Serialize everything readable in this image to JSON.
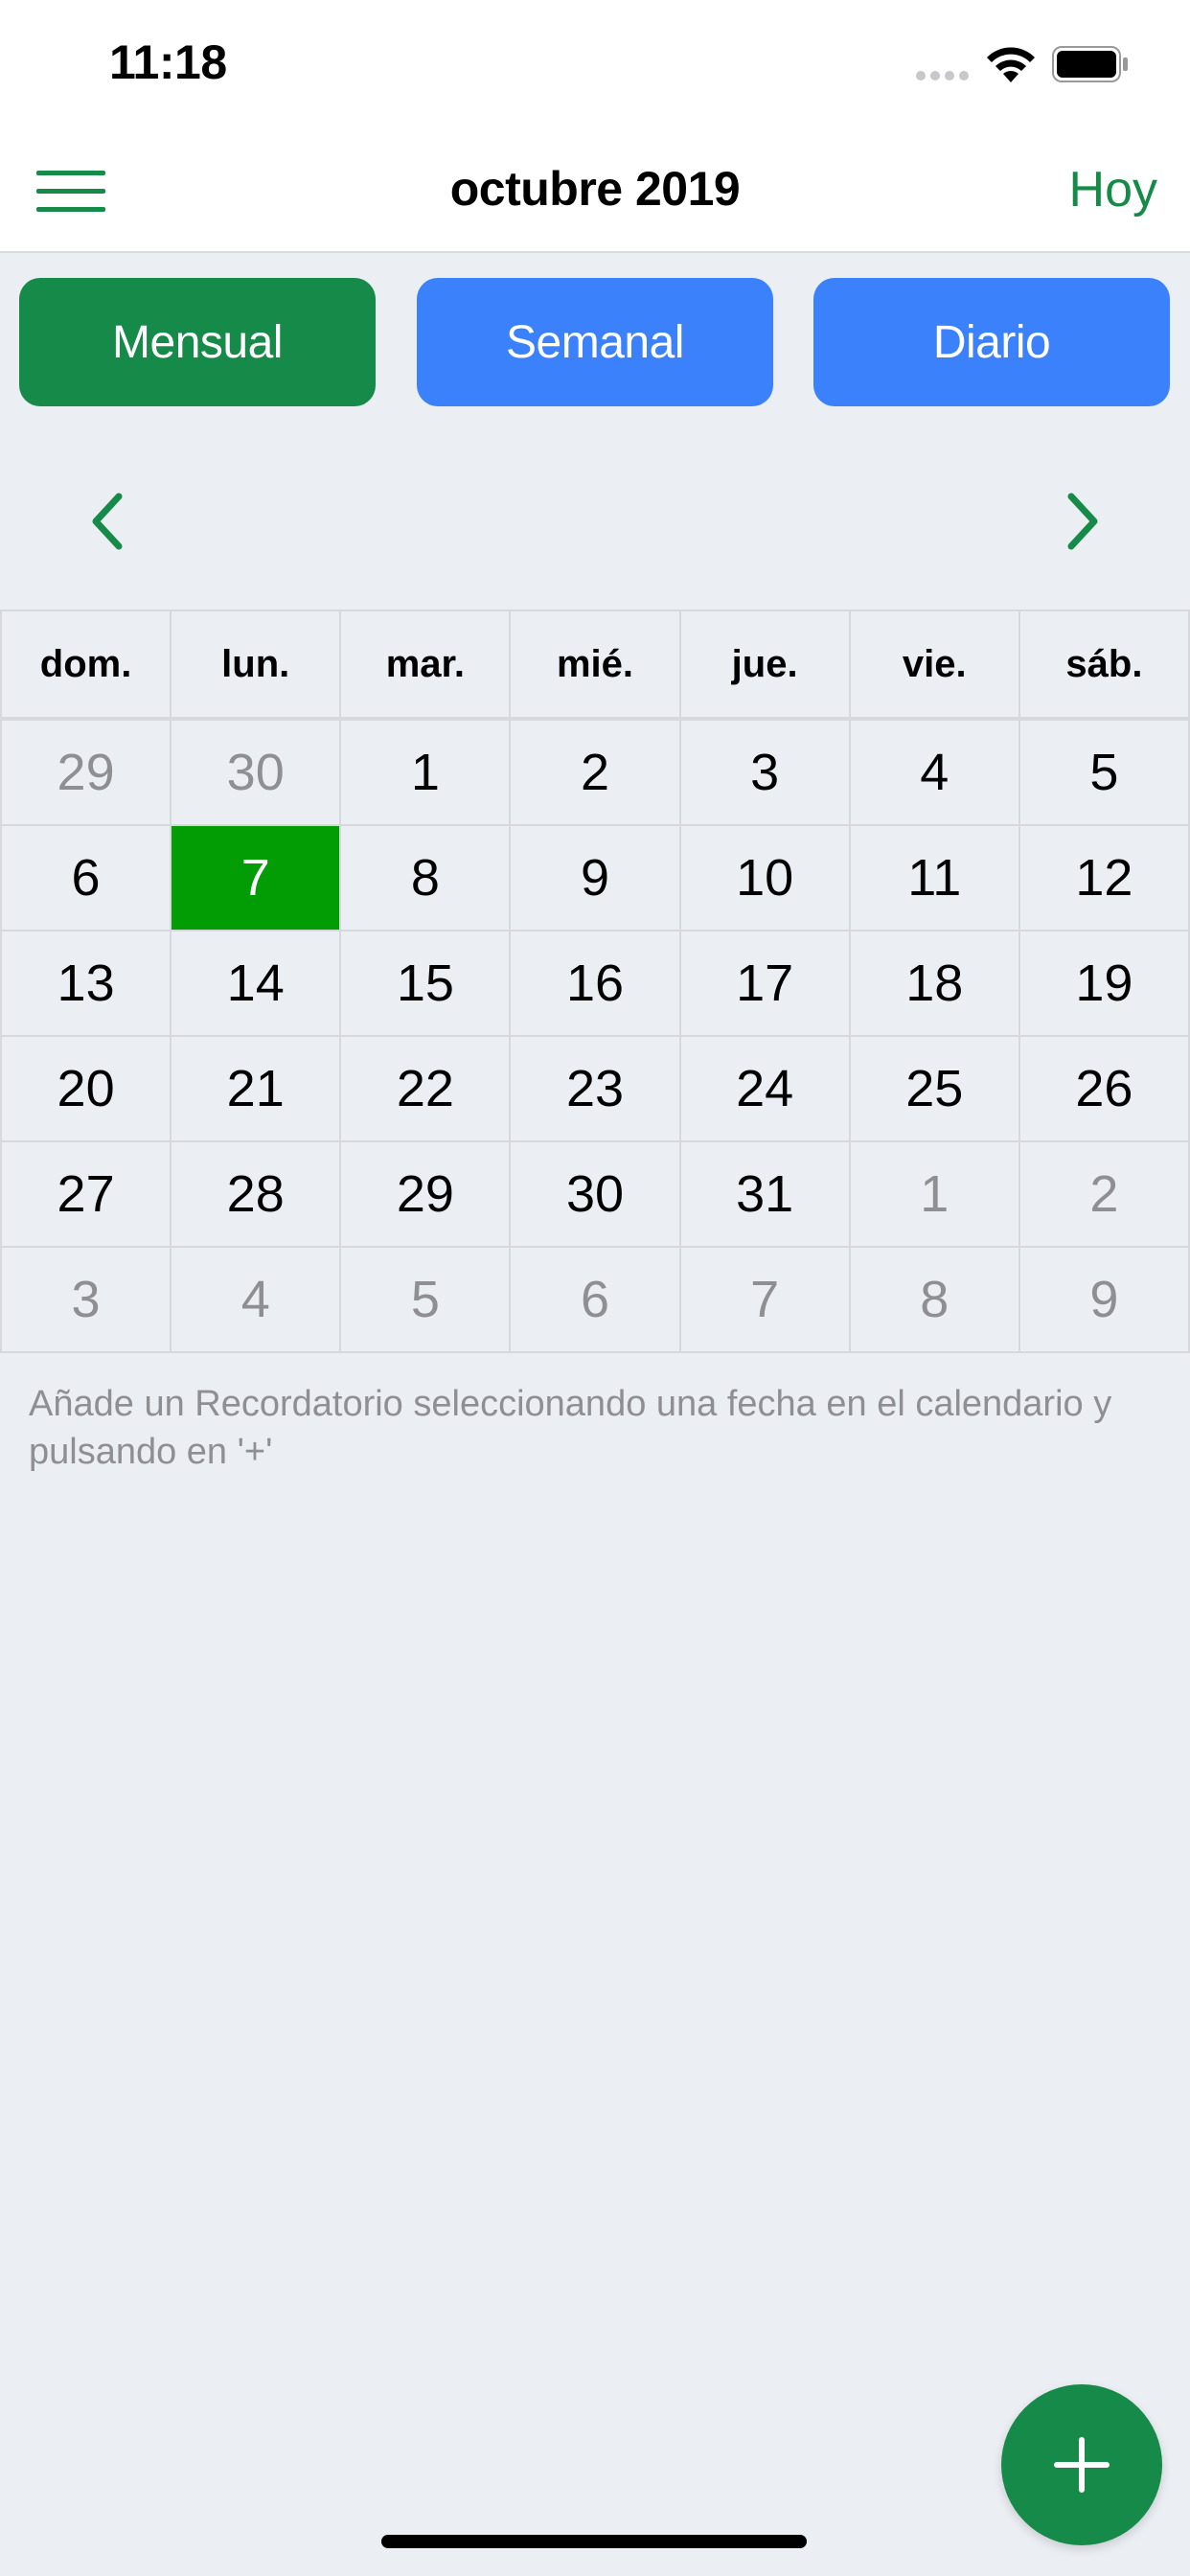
{
  "status_bar": {
    "time": "11:18"
  },
  "nav": {
    "title": "octubre 2019",
    "today_label": "Hoy"
  },
  "view_buttons": {
    "monthly": "Mensual",
    "weekly": "Semanal",
    "daily": "Diario"
  },
  "calendar": {
    "weekdays": [
      "dom.",
      "lun.",
      "mar.",
      "mié.",
      "jue.",
      "vie.",
      "sáb."
    ],
    "weeks": [
      [
        "29",
        "30",
        "1",
        "2",
        "3",
        "4",
        "5"
      ],
      [
        "6",
        "7",
        "8",
        "9",
        "10",
        "11",
        "12"
      ],
      [
        "13",
        "14",
        "15",
        "16",
        "17",
        "18",
        "19"
      ],
      [
        "20",
        "21",
        "22",
        "23",
        "24",
        "25",
        "26"
      ],
      [
        "27",
        "28",
        "29",
        "30",
        "31",
        "1",
        "2"
      ],
      [
        "3",
        "4",
        "5",
        "6",
        "7",
        "8",
        "9"
      ]
    ],
    "selected_date": "7"
  },
  "hint": "Añade un Recordatorio seleccionando una fecha en el calendario y pulsando en '+'",
  "colors": {
    "accent_green": "#168a48",
    "selected_green": "#029d05",
    "blue": "#3a81fb"
  },
  "icons": {
    "menu": "hamburger-icon",
    "prev": "chevron-left-icon",
    "next": "chevron-right-icon",
    "add": "plus-icon"
  }
}
